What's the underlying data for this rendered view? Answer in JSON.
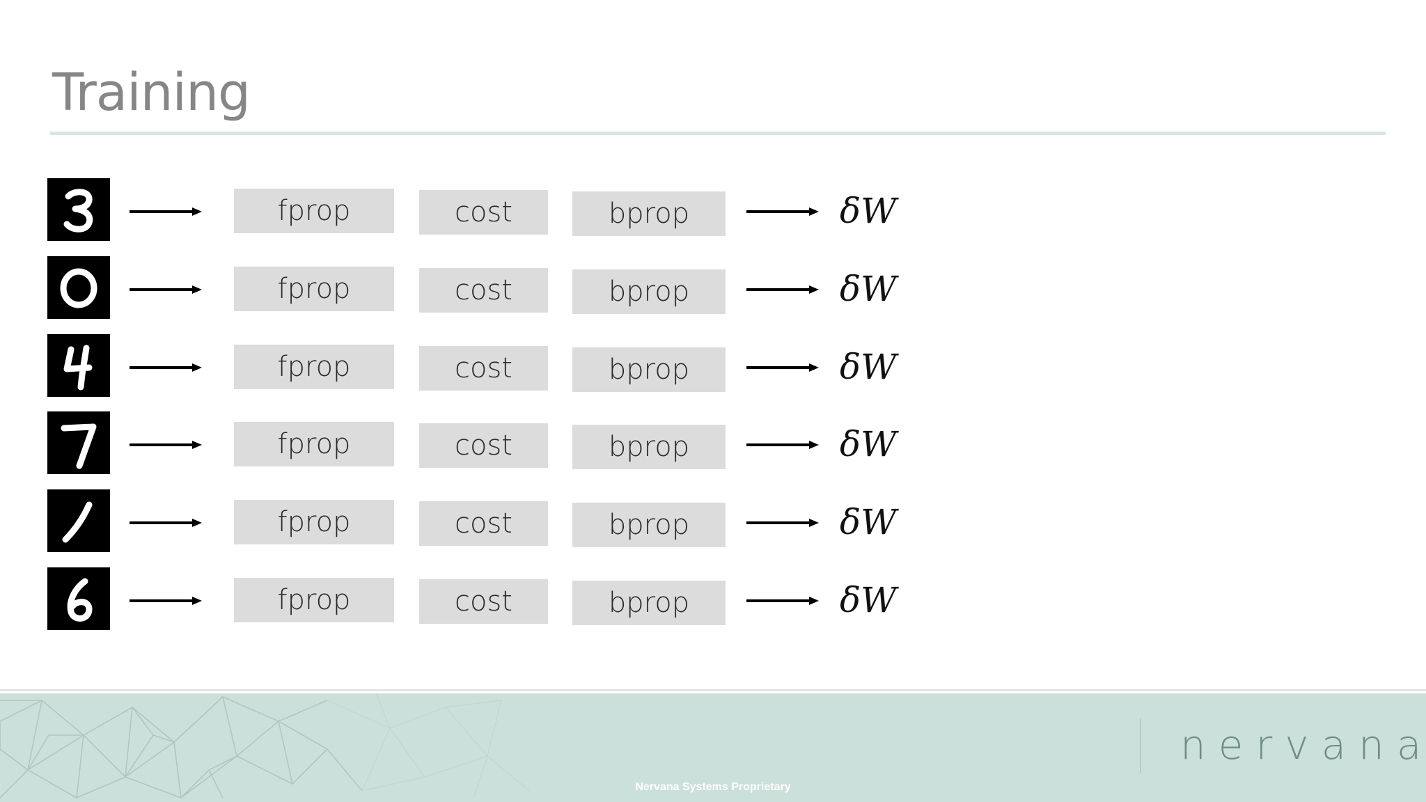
{
  "slide": {
    "title": "Training"
  },
  "diagram": {
    "rows": [
      {
        "digit": "3",
        "steps": [
          "fprop",
          "cost",
          "bprop"
        ],
        "output": "δW"
      },
      {
        "digit": "0",
        "steps": [
          "fprop",
          "cost",
          "bprop"
        ],
        "output": "δW"
      },
      {
        "digit": "4",
        "steps": [
          "fprop",
          "cost",
          "bprop"
        ],
        "output": "δW"
      },
      {
        "digit": "7",
        "steps": [
          "fprop",
          "cost",
          "bprop"
        ],
        "output": "δW"
      },
      {
        "digit": "1",
        "steps": [
          "fprop",
          "cost",
          "bprop"
        ],
        "output": "δW"
      },
      {
        "digit": "6",
        "steps": [
          "fprop",
          "cost",
          "bprop"
        ],
        "output": "δW"
      }
    ]
  },
  "footer": {
    "logo": "nervana",
    "proprietary": "Nervana Systems Proprietary"
  },
  "colors": {
    "title": "#868686",
    "box": "#dcdcdc",
    "footer": "#cbe0da",
    "rule": "#d9e6e2"
  }
}
